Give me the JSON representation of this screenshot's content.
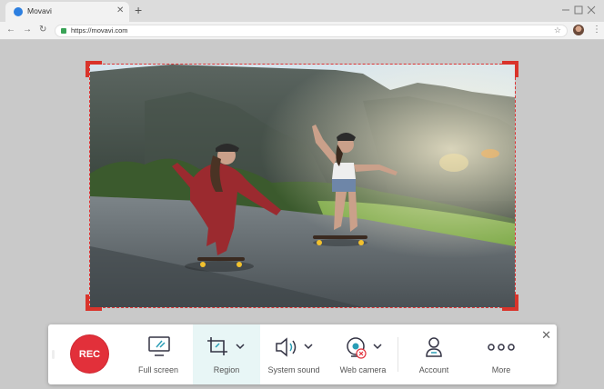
{
  "browser": {
    "tab_title": "Movavi",
    "url": "https://movavi.com",
    "icons": [
      "tab-favicon",
      "close-icon",
      "plus-icon",
      "back-arrow-icon",
      "forward-arrow-icon",
      "reload-icon",
      "lock-icon",
      "star-icon",
      "profile-avatar",
      "menu-dots-icon"
    ]
  },
  "capture": {
    "frame_color": "#d9342b",
    "image": "two skateboarders riding down a road with mountains behind"
  },
  "toolbar": {
    "rec_label": "REC",
    "rec_color": "#e2303a",
    "active_tool": "Region",
    "tools": [
      {
        "id": "fullscreen",
        "label": "Full screen",
        "icon": "fullscreen-icon",
        "has_dropdown": false
      },
      {
        "id": "region",
        "label": "Region",
        "icon": "crop-icon",
        "has_dropdown": true
      },
      {
        "id": "sound",
        "label": "System sound",
        "icon": "speaker-icon",
        "has_dropdown": true
      },
      {
        "id": "webcam",
        "label": "Web camera",
        "icon": "webcam-off-icon",
        "has_dropdown": true
      },
      {
        "id": "account",
        "label": "Account",
        "icon": "account-icon",
        "has_dropdown": false
      },
      {
        "id": "more",
        "label": "More",
        "icon": "more-dots-icon",
        "has_dropdown": false
      }
    ],
    "close_label": "✕"
  }
}
